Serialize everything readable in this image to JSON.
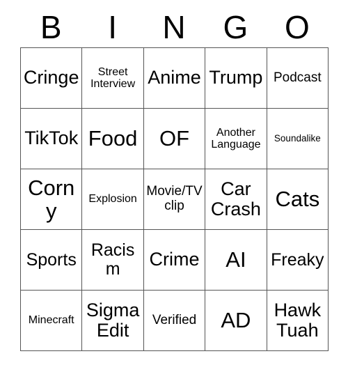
{
  "card": {
    "title": "BINGO",
    "header": [
      "B",
      "I",
      "N",
      "G",
      "O"
    ],
    "colors": {
      "background": "#ffffff",
      "text": "#000000",
      "grid_line": "#555555"
    },
    "rows": [
      [
        {
          "label": "Cringe",
          "size": "lg"
        },
        {
          "label": "Street Interview",
          "size": "xs"
        },
        {
          "label": "Anime",
          "size": "lg"
        },
        {
          "label": "Trump",
          "size": "lg"
        },
        {
          "label": "Podcast",
          "size": "sm"
        }
      ],
      [
        {
          "label": "TikTok",
          "size": "lg"
        },
        {
          "label": "Food",
          "size": "xl"
        },
        {
          "label": "OF",
          "size": "xl"
        },
        {
          "label": "Another Language",
          "size": "xs"
        },
        {
          "label": "Soundalike",
          "size": "xxs"
        }
      ],
      [
        {
          "label": "Corny",
          "size": "xl"
        },
        {
          "label": "Explosion",
          "size": "xs"
        },
        {
          "label": "Movie/TV clip",
          "size": "sm"
        },
        {
          "label": "Car Crash",
          "size": "lg"
        },
        {
          "label": "Cats",
          "size": "xl"
        }
      ],
      [
        {
          "label": "Sports",
          "size": "md"
        },
        {
          "label": "Racism",
          "size": "md"
        },
        {
          "label": "Crime",
          "size": "lg"
        },
        {
          "label": "AI",
          "size": "xl"
        },
        {
          "label": "Freaky",
          "size": "md"
        }
      ],
      [
        {
          "label": "Minecraft",
          "size": "xs"
        },
        {
          "label": "Sigma Edit",
          "size": "lg"
        },
        {
          "label": "Verified",
          "size": "sm"
        },
        {
          "label": "AD",
          "size": "xl"
        },
        {
          "label": "Hawk Tuah",
          "size": "lg"
        }
      ]
    ]
  }
}
